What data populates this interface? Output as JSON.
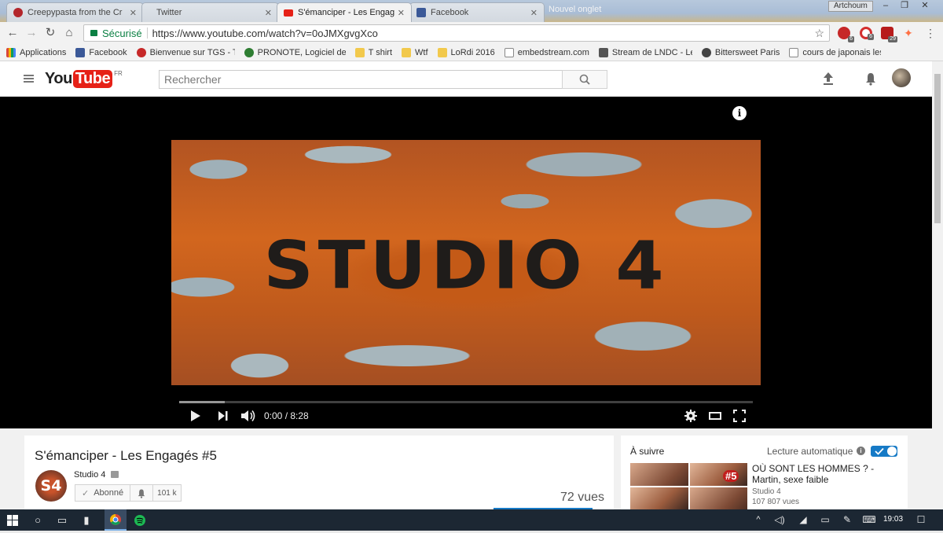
{
  "browser": {
    "tabs": [
      {
        "label": "Creepypasta from the Cr",
        "favicon_color": "#b3262b"
      },
      {
        "label": "Twitter",
        "favicon_color": "#55acee"
      },
      {
        "label": "S'émanciper - Les Engag",
        "favicon_color": "#e62117"
      },
      {
        "label": "Facebook",
        "favicon_color": "#3b5998"
      }
    ],
    "ghost_tab": "Nouvel onglet",
    "profile_name": "Artchoum",
    "secure_label": "Sécurisé",
    "url": "https://www.youtube.com/watch?v=0oJMXgvgXco",
    "extensions": [
      {
        "name": "adblock",
        "badge": "6",
        "color": "#c62828"
      },
      {
        "name": "opera",
        "badge": "6",
        "color": "#d32f2f"
      },
      {
        "name": "ublock",
        "badge": "29",
        "color": "#b71c1c"
      },
      {
        "name": "extension",
        "badge": "",
        "color": "#ff7043"
      }
    ],
    "bookmarks": [
      {
        "label": "Applications",
        "icon": "apps-grid-icon",
        "color": "#d9473a"
      },
      {
        "label": "Facebook",
        "icon": "facebook-icon",
        "color": "#3b5998"
      },
      {
        "label": "Bienvenue sur TGS - T",
        "icon": "tgs-icon",
        "color": "#c62828"
      },
      {
        "label": "PRONOTE, Logiciel de",
        "icon": "pronote-icon",
        "color": "#2e7d32"
      },
      {
        "label": "T shirt",
        "icon": "folder-icon",
        "color": "#f2c94c"
      },
      {
        "label": "Wtf",
        "icon": "folder-icon",
        "color": "#f2c94c"
      },
      {
        "label": "LoRdi 2016",
        "icon": "folder-icon",
        "color": "#f2c94c"
      },
      {
        "label": "embedstream.com",
        "icon": "page-icon",
        "color": "#888888"
      },
      {
        "label": "Stream de LNDC - Le",
        "icon": "stream-icon",
        "color": "#555555"
      },
      {
        "label": "Bittersweet Paris",
        "icon": "bittersweet-icon",
        "color": "#444444"
      },
      {
        "label": "cours de japonais les",
        "icon": "page-icon",
        "color": "#888888"
      }
    ]
  },
  "youtube": {
    "region": "FR",
    "search_placeholder": "Rechercher",
    "player": {
      "frame_text": "STUDIO 4",
      "current_time": "0:00",
      "duration": "8:28",
      "time_display": "0:00 / 8:28",
      "progress": 0.0
    },
    "video": {
      "title": "S'émanciper - Les Engagés #5",
      "channel": "Studio 4",
      "channel_avatar_text": "S4",
      "subscribe_label": "Abonné",
      "subscriber_count": "101 k",
      "views": "72 vues"
    },
    "sidebar": {
      "up_next_label": "À suivre",
      "autoplay_label": "Lecture automatique",
      "autoplay_on": true,
      "recommendation": {
        "title": "OÙ SONT LES HOMMES ? - Martin, sexe faible",
        "badge": "#5",
        "channel": "Studio 4",
        "views": "107 807 vues"
      }
    }
  },
  "taskbar": {
    "time": "19:03"
  }
}
